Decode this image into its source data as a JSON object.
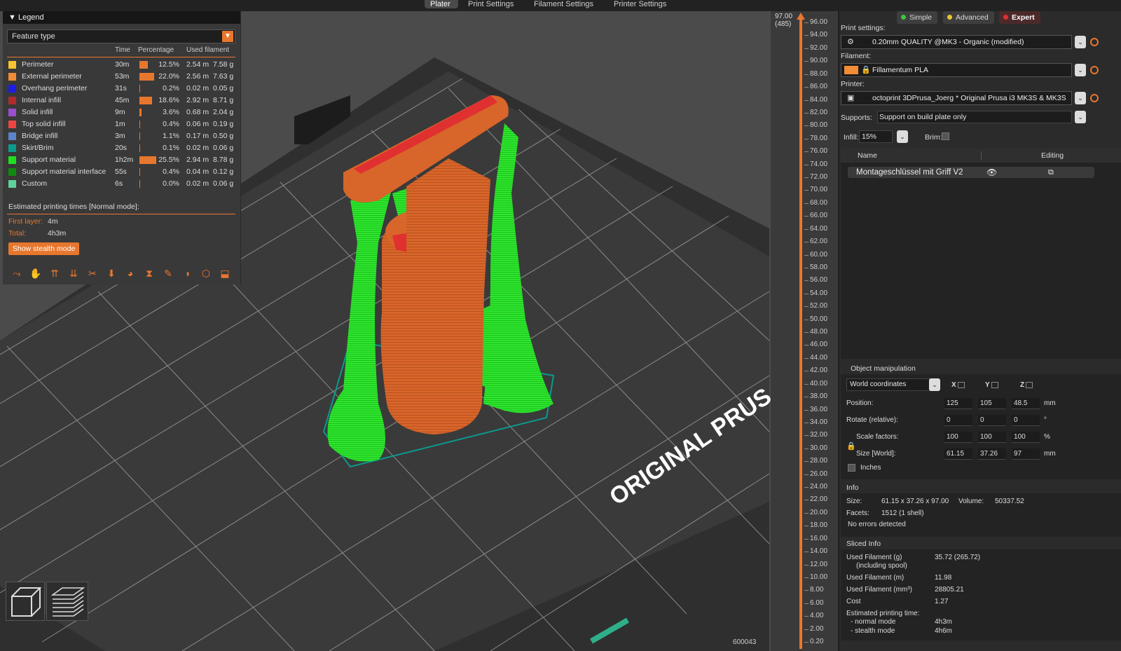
{
  "tabs": [
    "Plater",
    "Print Settings",
    "Filament Settings",
    "Printer Settings"
  ],
  "legend": {
    "title": "Legend",
    "feature_type": "Feature type",
    "columns": {
      "time": "Time",
      "percentage": "Percentage",
      "used_filament": "Used filament"
    },
    "rows": [
      {
        "name": "Perimeter",
        "color": "#f7c230",
        "time": "30m",
        "percent": "12.5%",
        "pct_value": 12.5,
        "meters": "2.54 m",
        "grams": "7.58 g"
      },
      {
        "name": "External perimeter",
        "color": "#f28c36",
        "time": "53m",
        "percent": "22.0%",
        "pct_value": 22.0,
        "meters": "2.56 m",
        "grams": "7.63 g"
      },
      {
        "name": "Overhang perimeter",
        "color": "#1d1de6",
        "time": "31s",
        "percent": "0.2%",
        "pct_value": 0.2,
        "meters": "0.02 m",
        "grams": "0.05 g"
      },
      {
        "name": "Internal infill",
        "color": "#b02b2b",
        "time": "45m",
        "percent": "18.6%",
        "pct_value": 18.6,
        "meters": "2.92 m",
        "grams": "8.71 g"
      },
      {
        "name": "Solid infill",
        "color": "#9a4fd1",
        "time": "9m",
        "percent": "3.6%",
        "pct_value": 3.6,
        "meters": "0.68 m",
        "grams": "2.04 g"
      },
      {
        "name": "Top solid infill",
        "color": "#ef4444",
        "time": "1m",
        "percent": "0.4%",
        "pct_value": 0.4,
        "meters": "0.06 m",
        "grams": "0.19 g"
      },
      {
        "name": "Bridge infill",
        "color": "#5d84c9",
        "time": "3m",
        "percent": "1.1%",
        "pct_value": 1.1,
        "meters": "0.17 m",
        "grams": "0.50 g"
      },
      {
        "name": "Skirt/Brim",
        "color": "#0a9b8d",
        "time": "20s",
        "percent": "0.1%",
        "pct_value": 0.1,
        "meters": "0.02 m",
        "grams": "0.06 g"
      },
      {
        "name": "Support material",
        "color": "#1fe01f",
        "time": "1h2m",
        "percent": "25.5%",
        "pct_value": 25.5,
        "meters": "2.94 m",
        "grams": "8.78 g"
      },
      {
        "name": "Support material interface",
        "color": "#108a10",
        "time": "55s",
        "percent": "0.4%",
        "pct_value": 0.4,
        "meters": "0.04 m",
        "grams": "0.12 g"
      },
      {
        "name": "Custom",
        "color": "#5fd19b",
        "time": "6s",
        "percent": "0.0%",
        "pct_value": 0.0,
        "meters": "0.02 m",
        "grams": "0.06 g"
      }
    ],
    "estimated_title": "Estimated printing times [Normal mode]:",
    "first_layer_label": "First layer:",
    "first_layer_value": "4m",
    "total_label": "Total:",
    "total_value": "4h3m",
    "stealth_button": "Show stealth mode",
    "tool_icons": [
      "travel-icon",
      "wipe-icon",
      "retractions-icon",
      "deretractions-icon",
      "seams-icon",
      "tool-changes-icon",
      "color-changes-icon",
      "pause-icon",
      "custom-gcode-icon",
      "center-of-gravity-icon",
      "shells-icon",
      "tool-marker-icon"
    ]
  },
  "viewport": {
    "bed_text": "ORIGINAL PRUS",
    "layer_id": "600043"
  },
  "slider": {
    "top_value": "97.00",
    "top_layer": "(485)",
    "ticks": [
      "96.00",
      "94.00",
      "92.00",
      "90.00",
      "88.00",
      "86.00",
      "84.00",
      "82.00",
      "80.00",
      "78.00",
      "76.00",
      "74.00",
      "72.00",
      "70.00",
      "68.00",
      "66.00",
      "64.00",
      "62.00",
      "60.00",
      "58.00",
      "56.00",
      "54.00",
      "52.00",
      "50.00",
      "48.00",
      "46.00",
      "44.00",
      "42.00",
      "40.00",
      "38.00",
      "36.00",
      "34.00",
      "32.00",
      "30.00",
      "28.00",
      "26.00",
      "24.00",
      "22.00",
      "20.00",
      "18.00",
      "16.00",
      "14.00",
      "12.00",
      "10.00",
      "8.00",
      "6.00",
      "4.00",
      "2.00",
      "0.20"
    ]
  },
  "panel": {
    "modes": [
      {
        "label": "Simple",
        "color": "#3cc63c"
      },
      {
        "label": "Advanced",
        "color": "#e8c52e"
      },
      {
        "label": "Expert",
        "color": "#e03030"
      }
    ],
    "print_settings_label": "Print settings:",
    "print_settings_value": "0.20mm QUALITY @MK3 - Organic (modified)",
    "filament_label": "Filament:",
    "filament_value": "Fillamentum PLA",
    "filament_color": "#f28c36",
    "printer_label": "Printer:",
    "printer_value": "octoprint  3DPrusa_Joerg * Original Prusa i3 MK3S & MK3S",
    "supports_label": "Supports:",
    "supports_value": "Support on build plate only",
    "infill_label": "Infill:",
    "infill_value": "15%",
    "brim_label": "Brim:",
    "list_name_header": "Name",
    "list_editing_header": "Editing",
    "object_name": "Montageschlüssel mit Griff V2",
    "object_manipulation": {
      "title": "Object manipulation",
      "coords": "World coordinates",
      "axes": [
        "X",
        "Y",
        "Z"
      ],
      "position_label": "Position:",
      "position": [
        "125",
        "105",
        "48.5"
      ],
      "position_unit": "mm",
      "rotate_label": "Rotate (relative):",
      "rotate": [
        "0",
        "0",
        "0"
      ],
      "rotate_unit": "°",
      "scale_label": "Scale factors:",
      "scale": [
        "100",
        "100",
        "100"
      ],
      "scale_unit": "%",
      "size_label": "Size [World]:",
      "size": [
        "61.15",
        "37.26",
        "97"
      ],
      "size_unit": "mm",
      "inches_label": "Inches"
    },
    "info": {
      "title": "Info",
      "size_label": "Size:",
      "size_value": "61.15 x 37.26 x 97.00",
      "volume_label": "Volume:",
      "volume_value": "50337.52",
      "facets_label": "Facets:",
      "facets_value": "1512 (1 shell)",
      "errors": "No errors detected"
    },
    "sliced": {
      "title": "Sliced Info",
      "used_g_label": "Used Filament (g)",
      "used_g_sub": "(including spool)",
      "used_g_value": "35.72 (265.72)",
      "used_m_label": "Used Filament (m)",
      "used_m_value": "11.98",
      "used_mm3_label": "Used Filament (mm³)",
      "used_mm3_value": "28805.21",
      "cost_label": "Cost",
      "cost_value": "1.27",
      "est_label": "Estimated printing time:",
      "normal_label": "- normal mode",
      "normal_value": "4h3m",
      "stealth_label": "- stealth mode",
      "stealth_value": "4h6m"
    }
  }
}
